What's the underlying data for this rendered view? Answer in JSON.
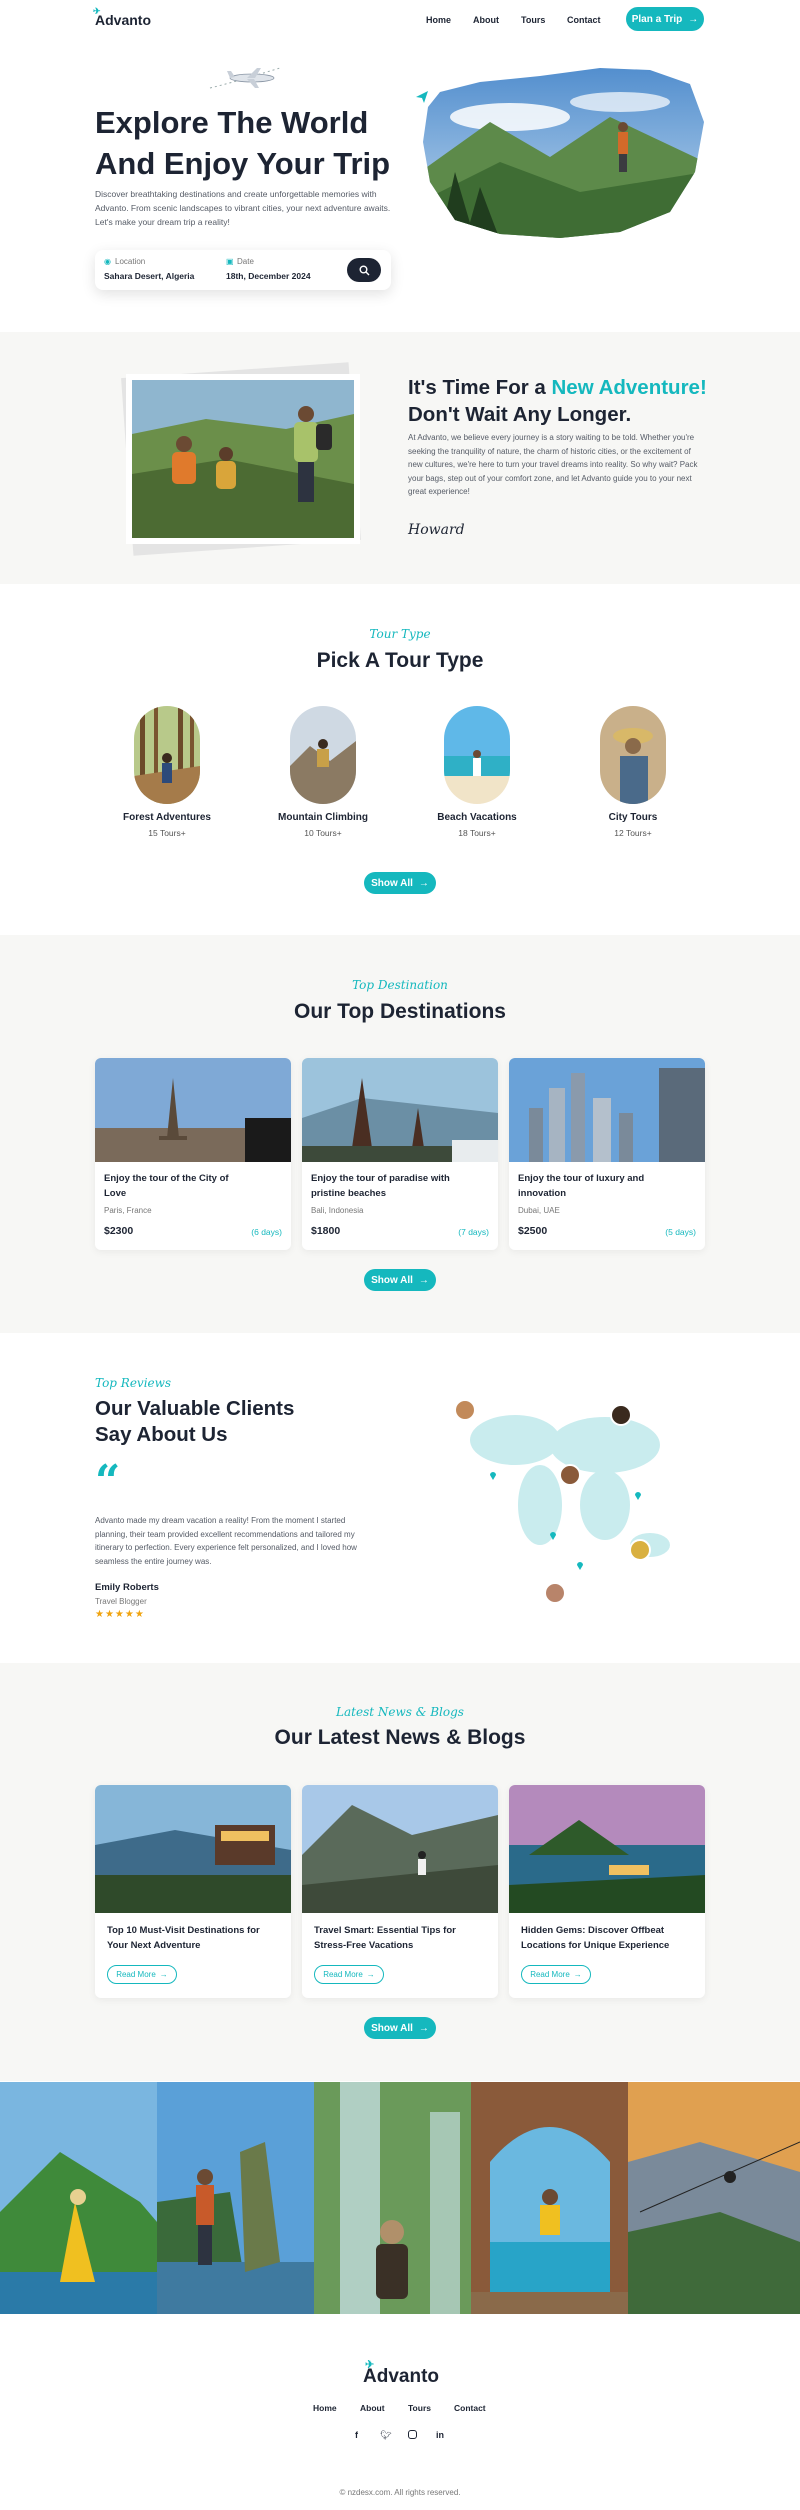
{
  "brand": {
    "name": "Advanto",
    "accent": "#15b8be",
    "dark": "#1d2433"
  },
  "nav": {
    "home": "Home",
    "about": "About",
    "tours": "Tours",
    "contact": "Contact",
    "cta": "Plan a Trip"
  },
  "hero": {
    "title_line1": "Explore The World",
    "title_line2": "And Enjoy Your Trip",
    "description": "Discover breathtaking destinations and create unforgettable memories with Advanto. From scenic landscapes to vibrant cities, your next adventure awaits. Let's make your dream trip a reality!",
    "location_label": "Location",
    "location_value": "Sahara Desert, Algeria",
    "date_label": "Date",
    "date_value": "18th, December 2024"
  },
  "about": {
    "title_part1": "It's Time For a ",
    "title_highlight": "New Adventure!",
    "title_line2": "Don't Wait Any Longer.",
    "body": "At Advanto, we believe every journey is a story waiting to be told. Whether you're seeking the tranquility of nature, the charm of historic cities, or the excitement of new cultures, we're here to turn your travel dreams into reality. So why wait? Pack your bags, step out of your comfort zone, and let Advanto guide you to your next great experience!",
    "signature": "Howard"
  },
  "tour_types": {
    "subtitle": "Tour Type",
    "title": "Pick A Tour Type",
    "button": "Show All",
    "items": [
      {
        "name": "Forest Adventures",
        "count": "15 Tours+"
      },
      {
        "name": "Mountain Climbing",
        "count": "10 Tours+"
      },
      {
        "name": "Beach Vacations",
        "count": "18 Tours+"
      },
      {
        "name": "City Tours",
        "count": "12 Tours+"
      }
    ]
  },
  "destinations": {
    "subtitle": "Top Destination",
    "title": "Our Top Destinations",
    "button": "Show All",
    "items": [
      {
        "title": "Enjoy the tour of the City of Love",
        "location": "Paris, France",
        "price": "$2300",
        "days": "(6 days)"
      },
      {
        "title": "Enjoy the tour of paradise with pristine beaches",
        "location": "Bali, Indonesia",
        "price": "$1800",
        "days": "(7 days)"
      },
      {
        "title": "Enjoy the tour of luxury and innovation",
        "location": "Dubai, UAE",
        "price": "$2500",
        "days": "(5 days)"
      }
    ]
  },
  "reviews": {
    "subtitle": "Top Reviews",
    "title_line1": "Our Valuable Clients",
    "title_line2": "Say About Us",
    "quote": "Advanto made my dream vacation a reality! From the moment I started planning, their team provided excellent recommendations and tailored my itinerary to perfection. Every experience felt personalized, and I loved how seamless the entire journey was.",
    "name": "Emily Roberts",
    "role": "Travel Blogger",
    "stars": 5
  },
  "news": {
    "subtitle": "Latest News & Blogs",
    "title": "Our Latest News & Blogs",
    "button": "Show All",
    "read_more": "Read More",
    "items": [
      {
        "title": "Top 10 Must-Visit Destinations for Your Next Adventure"
      },
      {
        "title": "Travel Smart: Essential Tips for Stress-Free Vacations"
      },
      {
        "title": "Hidden Gems: Discover Offbeat Locations for Unique Experience"
      }
    ]
  },
  "footer": {
    "home": "Home",
    "about": "About",
    "tours": "Tours",
    "contact": "Contact",
    "copyright": "© nzdesx.com. All rights reserved."
  }
}
